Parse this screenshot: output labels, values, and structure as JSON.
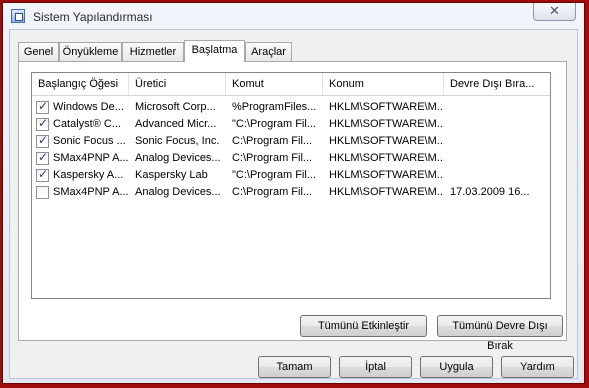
{
  "window": {
    "title": "Sistem Yapılandırması",
    "close_glyph": "✕"
  },
  "tabs": [
    {
      "label": "Genel"
    },
    {
      "label": "Önyükleme"
    },
    {
      "label": "Hizmetler"
    },
    {
      "label": "Başlatma",
      "active": true
    },
    {
      "label": "Araçlar"
    }
  ],
  "startup_list": {
    "columns": [
      "Başlangıç Öğesi",
      "Üretici",
      "Komut",
      "Konum",
      "Devre Dışı Bıra..."
    ],
    "rows": [
      {
        "checked": true,
        "item": "Windows De...",
        "manufacturer": "Microsoft Corp...",
        "command": "%ProgramFiles...",
        "location": "HKLM\\SOFTWARE\\M...",
        "disabled": ""
      },
      {
        "checked": true,
        "item": "Catalyst® C...",
        "manufacturer": "Advanced Micr...",
        "command": "\"C:\\Program Fil...",
        "location": "HKLM\\SOFTWARE\\M...",
        "disabled": ""
      },
      {
        "checked": true,
        "item": "Sonic Focus ...",
        "manufacturer": "Sonic Focus, Inc.",
        "command": "C:\\Program Fil...",
        "location": "HKLM\\SOFTWARE\\M...",
        "disabled": ""
      },
      {
        "checked": true,
        "item": "SMax4PNP A...",
        "manufacturer": "Analog Devices...",
        "command": "C:\\Program Fil...",
        "location": "HKLM\\SOFTWARE\\M...",
        "disabled": ""
      },
      {
        "checked": true,
        "item": "Kaspersky A...",
        "manufacturer": "Kaspersky Lab",
        "command": "\"C:\\Program Fil...",
        "location": "HKLM\\SOFTWARE\\M...",
        "disabled": ""
      },
      {
        "checked": false,
        "item": "SMax4PNP A...",
        "manufacturer": "Analog Devices...",
        "command": "C:\\Program Fil...",
        "location": "HKLM\\SOFTWARE\\M...",
        "disabled": "17.03.2009 16..."
      }
    ]
  },
  "panel_buttons": {
    "enable_all": "Tümünü Etkinleştir",
    "disable_all": "Tümünü Devre Dışı Bırak"
  },
  "dialog_buttons": {
    "ok": "Tamam",
    "cancel": "İptal",
    "apply": "Uygula",
    "help": "Yardım"
  }
}
